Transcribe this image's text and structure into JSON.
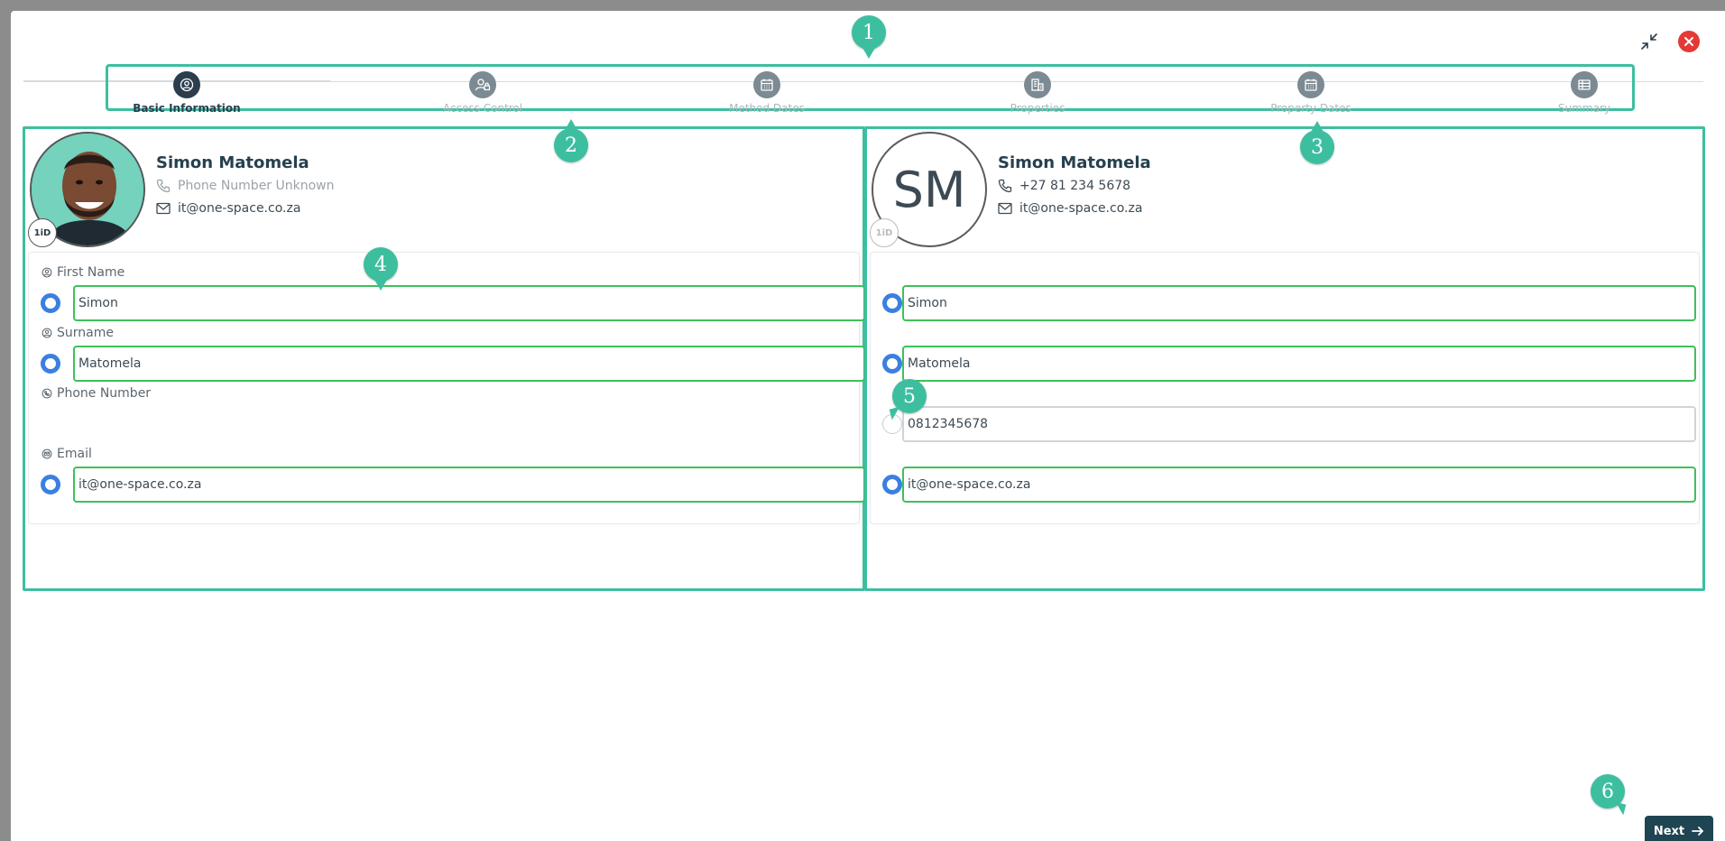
{
  "colors": {
    "accent": "#3dbf9f",
    "radio": "#3b7fe0",
    "valid": "#3ec05a",
    "primary": "#1f4452",
    "danger": "#e53935"
  },
  "window": {
    "minimize_icon": "collapse-arrows-icon",
    "close_icon": "close-icon"
  },
  "steps": [
    {
      "label": "Basic Information",
      "icon": "user-circle-icon",
      "active": true
    },
    {
      "label": "Access Control",
      "icon": "user-lock-icon",
      "active": false
    },
    {
      "label": "Method Dates",
      "icon": "calendar-icon",
      "active": false
    },
    {
      "label": "Properties",
      "icon": "building-icon",
      "active": false
    },
    {
      "label": "Property Dates",
      "icon": "calendar-icon",
      "active": false
    },
    {
      "label": "Summary",
      "icon": "table-icon",
      "active": false
    }
  ],
  "callouts": [
    "1",
    "2",
    "3",
    "4",
    "5",
    "6"
  ],
  "left": {
    "name": "Simon Matomela",
    "phone": "Phone Number Unknown",
    "email": "it@one-space.co.za",
    "id_badge": "1iD",
    "fields": {
      "first_name_label": "First Name",
      "first_name": "Simon",
      "surname_label": "Surname",
      "surname": "Matomela",
      "phone_label": "Phone Number",
      "email_label": "Email",
      "email": "it@one-space.co.za"
    }
  },
  "right": {
    "initials": "SM",
    "name": "Simon Matomela",
    "phone": "+27 81 234 5678",
    "email": "it@one-space.co.za",
    "id_badge": "1iD",
    "fields": {
      "first_name": "Simon",
      "surname": "Matomela",
      "phone": "0812345678",
      "email": "it@one-space.co.za"
    }
  },
  "footer": {
    "next_label": "Next"
  }
}
